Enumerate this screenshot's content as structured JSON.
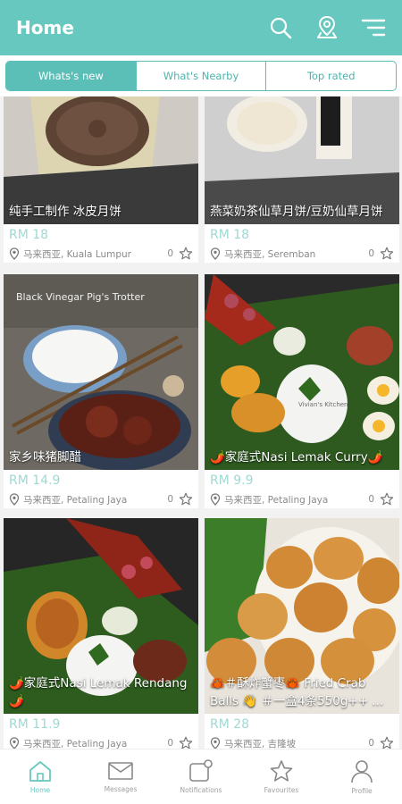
{
  "header": {
    "title": "Home",
    "search_icon": "search-icon",
    "location_icon": "location-icon",
    "filter_icon": "filter-icon",
    "color": "#67c8c0"
  },
  "tabs": [
    {
      "label": "Whats's new",
      "active": true
    },
    {
      "label": "What's Nearby",
      "active": false
    },
    {
      "label": "Top rated",
      "active": false
    }
  ],
  "listings": [
    {
      "caption": "纯手工制作 冰皮月饼",
      "price": "RM 18",
      "location": "马来西亚, Kuala Lumpur",
      "favorites": "0"
    },
    {
      "caption": "燕菜奶茶仙草月饼/豆奶仙草月饼",
      "price": "RM 18",
      "location": "马来西亚, Seremban",
      "favorites": "0"
    },
    {
      "caption": "家乡味猪脚醋",
      "price": "RM 14.9",
      "location": "马来西亚, Petaling Jaya",
      "favorites": "0",
      "photo_text": "Black Vinegar Pig's Trotter"
    },
    {
      "caption": "🌶️家庭式Nasi Lemak Curry🌶️",
      "price": "RM 9.9",
      "location": "马来西亚, Petaling Jaya",
      "favorites": "0",
      "photo_text": "Vivian's Kitchen"
    },
    {
      "caption": "🌶️家庭式Nasi Lemak Rendang🌶️",
      "price": "RM 11.9",
      "location": "马来西亚, Petaling Jaya",
      "favorites": "0"
    },
    {
      "caption": "🦀＃酥炸蟹枣🦀 Fried Crab Balls 👋 ＃一盒4条550g++ ...",
      "price": "RM 28",
      "location": "马来西亚, 吉隆坡",
      "favorites": "0"
    }
  ],
  "bottom_nav": [
    {
      "label": "Home",
      "icon": "home-icon",
      "active": true
    },
    {
      "label": "Messages",
      "icon": "mail-icon",
      "active": false
    },
    {
      "label": "Notifications",
      "icon": "notification-icon",
      "active": false
    },
    {
      "label": "Favourites",
      "icon": "star-icon",
      "active": false
    },
    {
      "label": "Profile",
      "icon": "person-icon",
      "active": false
    }
  ]
}
